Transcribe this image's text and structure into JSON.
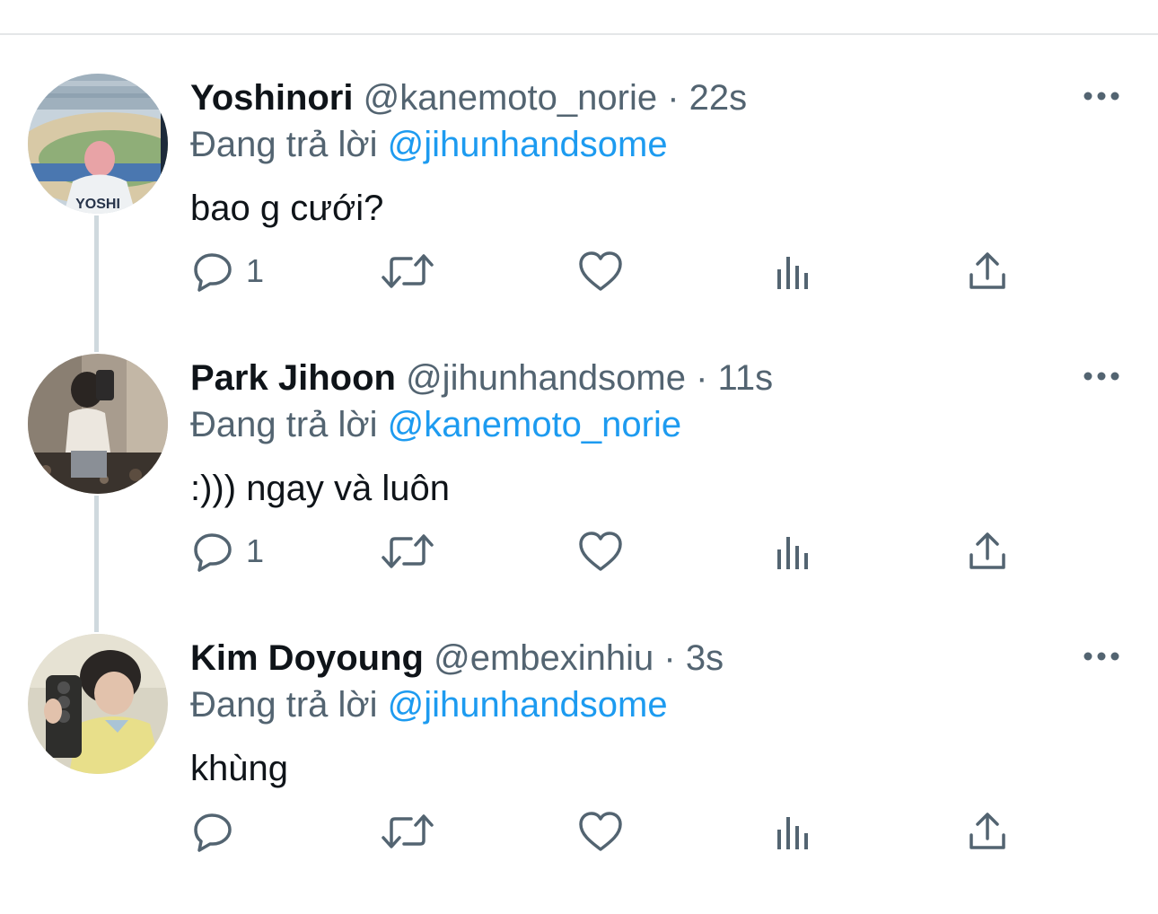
{
  "tweets": [
    {
      "display_name": "Yoshinori",
      "handle": "@kanemoto_norie",
      "separator": " · ",
      "time": "22s",
      "replying_label": "Đang trả lời ",
      "replying_to": "@jihunhandsome",
      "text": "bao g cưới?",
      "reply_count": "1",
      "avatar_caption": "YOSHI"
    },
    {
      "display_name": "Park Jihoon",
      "handle": "@jihunhandsome",
      "separator": " · ",
      "time": "11s",
      "replying_label": "Đang trả lời ",
      "replying_to": "@kanemoto_norie",
      "text": ":))) ngay và luôn",
      "reply_count": "1"
    },
    {
      "display_name": "Kim Doyoung",
      "handle": "@embexinhiu",
      "separator": " · ",
      "time": "3s",
      "replying_label": "Đang trả lời ",
      "replying_to": "@jihunhandsome",
      "text": "khùng",
      "reply_count": ""
    }
  ],
  "icons": {
    "reply": "speech-bubble-icon",
    "retweet": "retweet-arrows-icon",
    "like": "heart-icon",
    "views": "bar-chart-icon",
    "share": "share-upload-icon",
    "more": "ellipsis-icon"
  },
  "colors": {
    "text": "#0f1419",
    "secondary": "#536471",
    "mention": "#1d9bf0",
    "thread_line": "#cfd9de",
    "divider": "#e4e6e8"
  }
}
